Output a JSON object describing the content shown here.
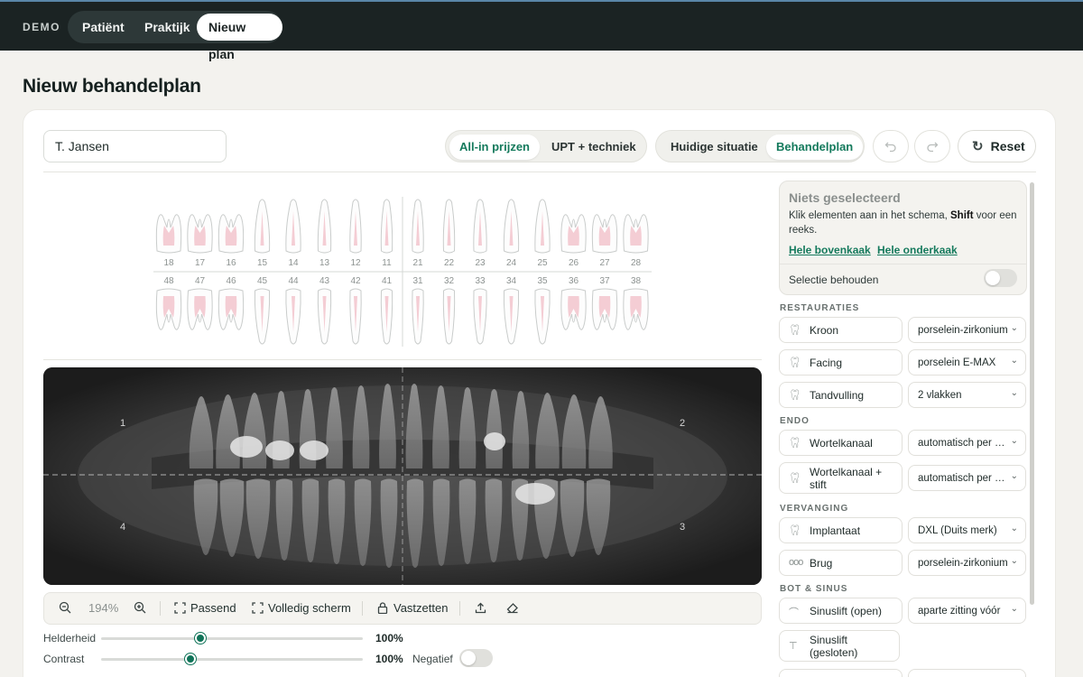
{
  "topbar": {
    "brand": "DEMO",
    "nav": [
      {
        "label": "Patiënt",
        "active": false
      },
      {
        "label": "Praktijk",
        "active": false
      },
      {
        "label": "Nieuw plan",
        "active": true
      }
    ]
  },
  "page": {
    "title": "Nieuw behandelplan"
  },
  "form": {
    "patient_name": "T. Jansen"
  },
  "pricing_toggle": {
    "options": [
      "All-in prijzen",
      "UPT + techniek"
    ],
    "selected": "All-in prijzen"
  },
  "view_toggle": {
    "options": [
      "Huidige situatie",
      "Behandelplan"
    ],
    "selected": "Behandelplan"
  },
  "actions": {
    "undo_icon": "undo-icon",
    "redo_icon": "redo-icon",
    "reset_label": "Reset",
    "reset_icon": "refresh-icon"
  },
  "tooth_chart": {
    "upper": [
      "18",
      "17",
      "16",
      "15",
      "14",
      "13",
      "12",
      "11",
      "21",
      "22",
      "23",
      "24",
      "25",
      "26",
      "27",
      "28"
    ],
    "lower": [
      "48",
      "47",
      "46",
      "45",
      "44",
      "43",
      "42",
      "41",
      "31",
      "32",
      "33",
      "34",
      "35",
      "36",
      "37",
      "38"
    ]
  },
  "xray": {
    "quadrants": [
      "1",
      "2",
      "3",
      "4"
    ]
  },
  "viewer_toolbar": {
    "zoom_out_icon": "zoom-out-icon",
    "zoom": "194%",
    "zoom_in_icon": "zoom-in-icon",
    "fit_label": "Passend",
    "fullscreen_label": "Volledig scherm",
    "lock_label": "Vastzetten",
    "export_icon": "upload-icon",
    "erase_icon": "eraser-icon"
  },
  "adjust": {
    "brightness": {
      "label": "Helderheid",
      "value": "100%",
      "level": 0.38
    },
    "contrast": {
      "label": "Contrast",
      "value": "100%",
      "level": 0.34
    },
    "negative_label": "Negatief",
    "negative_on": false
  },
  "selection_panel": {
    "title": "Niets geselecteerd",
    "hint_pre": "Klik elementen aan in het schema, ",
    "hint_bold": "Shift",
    "hint_post": " voor een reeks.",
    "link_upper": "Hele bovenkaak",
    "link_lower": "Hele onderkaak",
    "keep_label": "Selectie behouden",
    "keep_on": false
  },
  "sections": {
    "restauraties": "RESTAURATIES",
    "endo": "ENDO",
    "vervanging": "VERVANGING",
    "bot": "BOT & SINUS"
  },
  "treatments": {
    "kroon": {
      "label": "Kroon",
      "value": "porselein-zirkonium"
    },
    "facing": {
      "label": "Facing",
      "value": "porselein E-MAX"
    },
    "tandvulling": {
      "label": "Tandvulling",
      "value": "2 vlakken"
    },
    "wortelkanaal": {
      "label": "Wortelkanaal",
      "value": "automatisch per element"
    },
    "wortelkanaal_stift": {
      "label_1": "Wortelkanaal +",
      "label_2": "stift",
      "value": "automatisch per element"
    },
    "implantaat": {
      "label": "Implantaat",
      "value": "DXL (Duits merk)"
    },
    "brug": {
      "label": "Brug",
      "value": "porselein-zirkonium",
      "icon_text": "ooo"
    },
    "sinuslift_open": {
      "label": "Sinuslift (open)",
      "value": "aparte zitting vóór"
    },
    "sinuslift_gesloten": {
      "label_1": "Sinuslift",
      "label_2": "(gesloten)"
    }
  }
}
